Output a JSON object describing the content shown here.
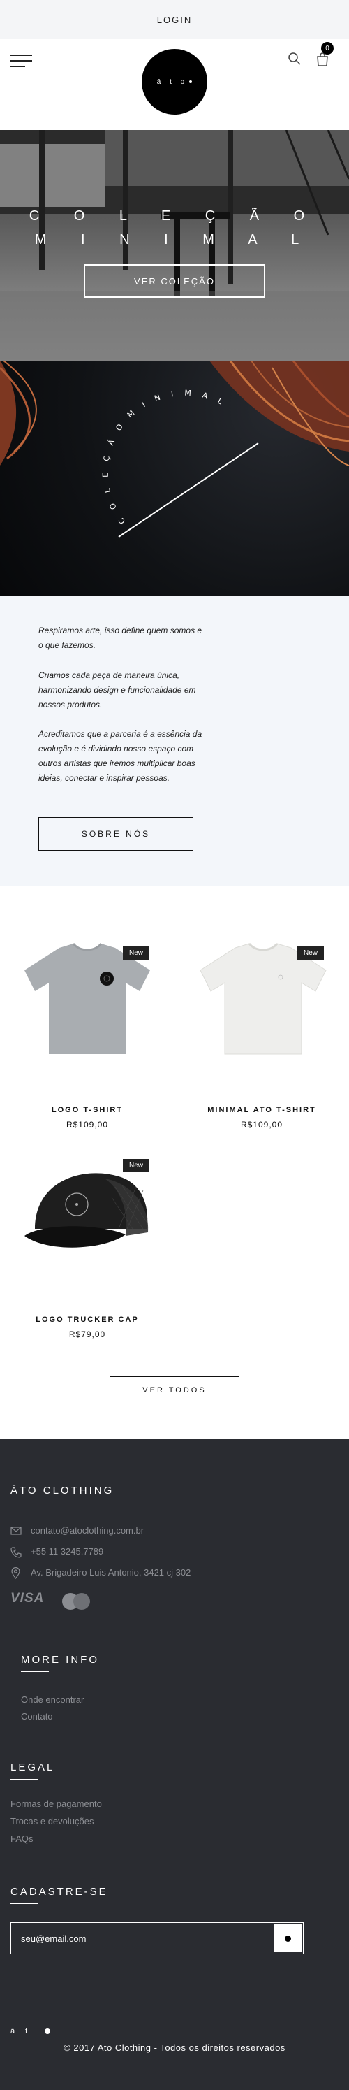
{
  "topbar": {
    "login": "LOGIN"
  },
  "header": {
    "logo_text": "ā t o",
    "cart_count": "0"
  },
  "hero": {
    "line1": "C O L E Ç Ã O",
    "line2": "M I N I M A L",
    "button": "VER COLEÇÃO"
  },
  "banner2": {
    "curved_text": "C O L E Ç Ã O   M I N I M A L"
  },
  "about": {
    "p1": "Respiramos arte, isso define quem somos e o que fazemos.",
    "p2": "Criamos cada peça de maneira única, harmonizando design e funcionalidade em nossos produtos.",
    "p3": "Acreditamos que a parceria é a essência da evolução e é dividindo nosso espaço com outros artistas que iremos multiplicar boas ideias, conectar e inspirar pessoas.",
    "button": "SOBRE NÓS"
  },
  "products": {
    "items": [
      {
        "badge": "New",
        "name": "LOGO T-SHIRT",
        "price": "R$109,00"
      },
      {
        "badge": "New",
        "name": "MINIMAL ATO T-SHIRT",
        "price": "R$109,00"
      },
      {
        "badge": "New",
        "name": "LOGO TRUCKER CAP",
        "price": "R$79,00"
      }
    ],
    "view_all": "VER TODOS"
  },
  "footer": {
    "brand": "ĀTO CLOTHING",
    "email": "contato@atoclothing.com.br",
    "phone": "+55 11 3245.7789",
    "address": "Av. Brigadeiro Luis Antonio, 3421 cj 302",
    "payment": {
      "visa": "VISA"
    },
    "more_info": {
      "title": "MORE INFO",
      "links": [
        "Onde encontrar",
        "Contato"
      ]
    },
    "legal": {
      "title": "LEGAL",
      "links": [
        "Formas de pagamento",
        "Trocas e devoluções",
        "FAQs"
      ]
    },
    "newsletter": {
      "title": "CADASTRE-SE",
      "placeholder": "seu@email.com"
    },
    "copyright": "© 2017 Ato Clothing - Todos os direitos reservados",
    "bottom_logo": "ā t"
  }
}
